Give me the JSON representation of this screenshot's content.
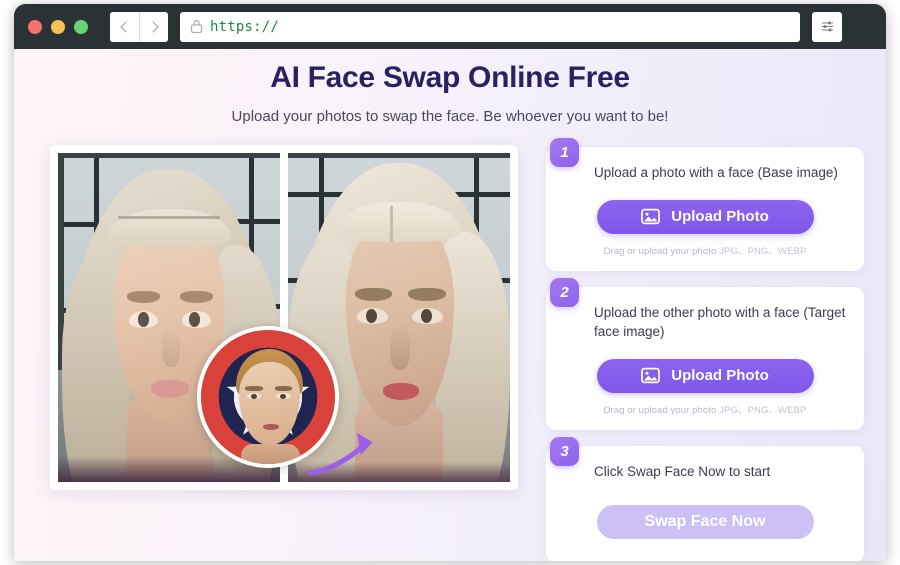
{
  "browser": {
    "traffic_lights": [
      "close-red",
      "minimize-yellow",
      "maximize-green"
    ],
    "back_label": "‹",
    "forward_label": "›",
    "url_value": "https://",
    "url_placeholder": "https://",
    "lock_icon": "lock-icon",
    "menu_icon": "sliders-menu-icon"
  },
  "page": {
    "title": "AI Face Swap Online Free",
    "subtitle": "Upload your photos to swap the face. Be whoever you want to be!"
  },
  "preview": {
    "base_photo_alt": "Blonde woman with braided hair, original photo",
    "result_photo_alt": "Blonde woman with swapped face, result photo",
    "source_face_alt": "Man's face on Captain America shield",
    "arrow_icon": "curved-arrow-icon"
  },
  "steps": [
    {
      "number": "1",
      "description": "Upload a photo with a face (Base image)",
      "button_label": "Upload Photo",
      "button_icon": "image-upload-icon",
      "hint_text": "Drag or upload your photo",
      "hint_formats": "JPG、PNG、WEBP"
    },
    {
      "number": "2",
      "description": "Upload the other photo with a face (Target face image)",
      "button_label": "Upload Photo",
      "button_icon": "image-upload-icon",
      "hint_text": "Drag or upload your photo",
      "hint_formats": "JPG、PNG、WEBP"
    },
    {
      "number": "3",
      "description": "Click Swap Face Now to start",
      "button_label": "Swap Face Now",
      "button_state": "disabled"
    }
  ],
  "colors": {
    "accent_purple": "#7e57ea",
    "badge_purple": "#8c63ec",
    "disabled_purple": "#cdc0f5",
    "title_navy": "#2b2062",
    "url_green": "#1f8b3d",
    "chrome_dark": "#2b3236"
  }
}
